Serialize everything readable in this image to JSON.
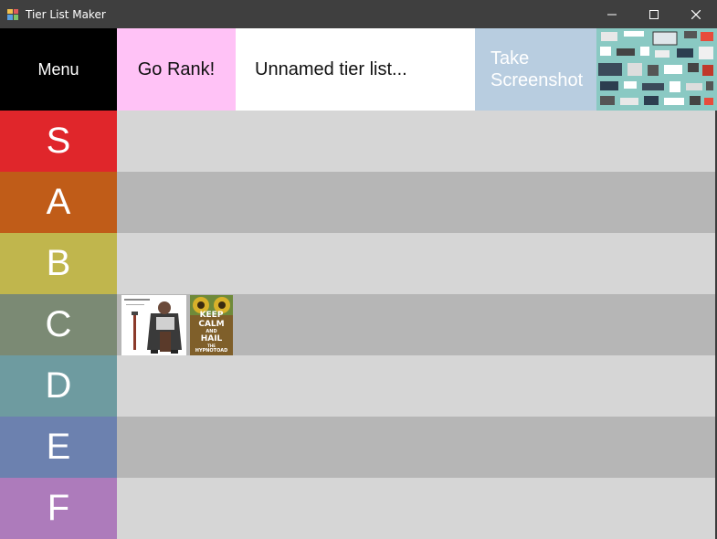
{
  "window": {
    "title": "Tier List Maker"
  },
  "toolbar": {
    "menu_label": "Menu",
    "go_rank_label": "Go Rank!",
    "title_value": "Unnamed tier list...",
    "screenshot_line1": "Take",
    "screenshot_line2": "Screenshot"
  },
  "tiers": [
    {
      "label": "S",
      "color": "#e0262b"
    },
    {
      "label": "A",
      "color": "#c05c18"
    },
    {
      "label": "B",
      "color": "#c0b64d"
    },
    {
      "label": "C",
      "color": "#7b8a74"
    },
    {
      "label": "D",
      "color": "#6e9ba0"
    },
    {
      "label": "E",
      "color": "#6c81af"
    },
    {
      "label": "F",
      "color": "#ad7bbb"
    }
  ],
  "tier_items": {
    "C": [
      {
        "name": "character-card"
      },
      {
        "name": "keep-calm-card",
        "lines": [
          "KEEP",
          "CALM",
          "AND",
          "HAIL",
          "THE",
          "HYPNOTOAD"
        ]
      }
    ]
  }
}
